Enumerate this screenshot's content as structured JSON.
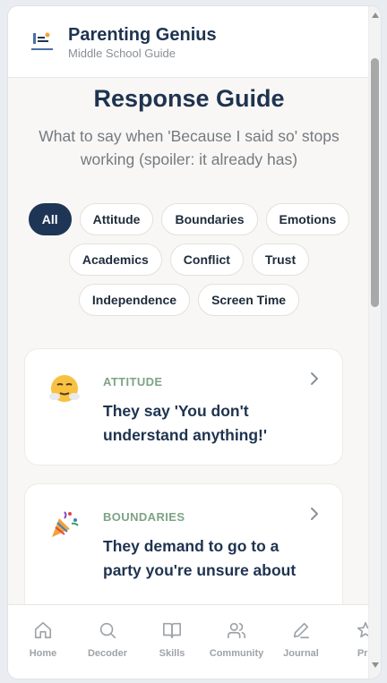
{
  "header": {
    "app_title": "Parenting Genius",
    "app_subtitle": "Middle School Guide"
  },
  "page": {
    "title": "Response Guide",
    "subtitle": "What to say when 'Because I said so' stops working (spoiler: it already has)"
  },
  "filters": [
    {
      "label": "All",
      "active": true
    },
    {
      "label": "Attitude",
      "active": false
    },
    {
      "label": "Boundaries",
      "active": false
    },
    {
      "label": "Emotions",
      "active": false
    },
    {
      "label": "Academics",
      "active": false
    },
    {
      "label": "Conflict",
      "active": false
    },
    {
      "label": "Trust",
      "active": false
    },
    {
      "label": "Independence",
      "active": false
    },
    {
      "label": "Screen Time",
      "active": false
    }
  ],
  "cards": [
    {
      "category": "ATTITUDE",
      "text": "They say 'You don't understand anything!'",
      "icon": "face-with-steam-emoji"
    },
    {
      "category": "BOUNDARIES",
      "text": "They demand to go to a party you're unsure about",
      "icon": "party-popper-emoji"
    }
  ],
  "nav": [
    {
      "label": "Home",
      "icon": "home-icon"
    },
    {
      "label": "Decoder",
      "icon": "search-icon"
    },
    {
      "label": "Skills",
      "icon": "book-icon"
    },
    {
      "label": "Community",
      "icon": "users-icon"
    },
    {
      "label": "Journal",
      "icon": "pen-icon"
    },
    {
      "label": "Pro",
      "icon": "star-icon"
    }
  ],
  "colors": {
    "primary": "#1f3556",
    "category": "#7ea386",
    "nav_inactive": "#9ea3a9"
  }
}
